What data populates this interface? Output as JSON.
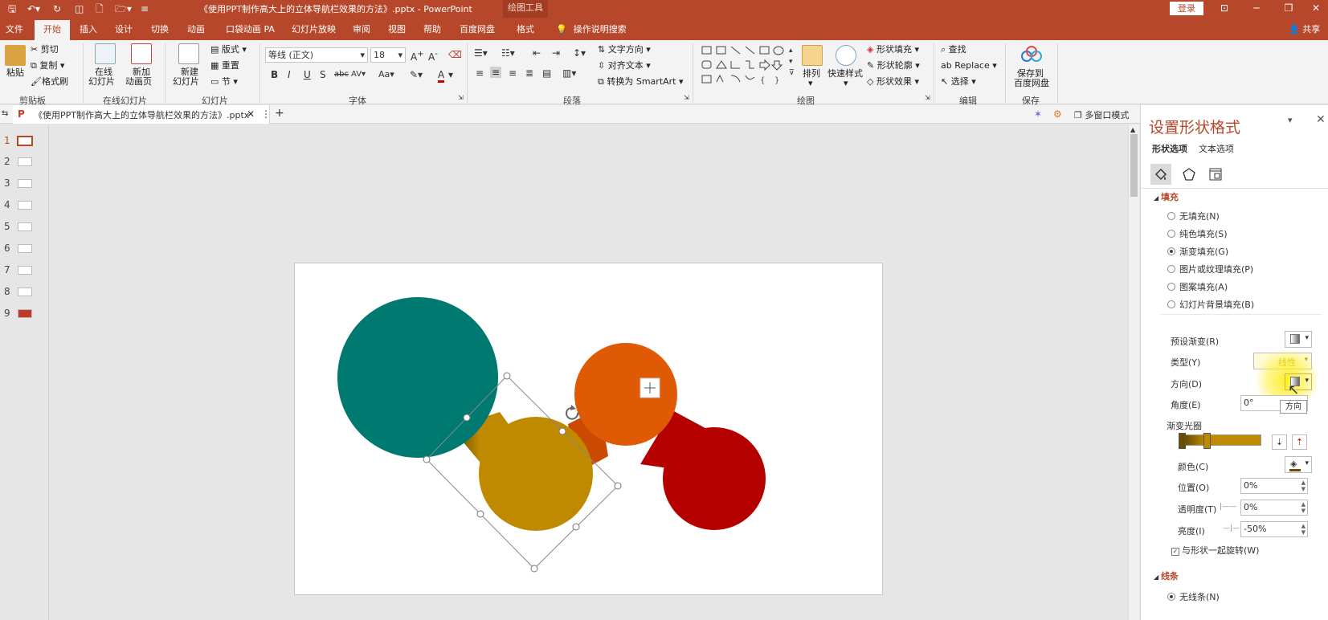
{
  "titlebar": {
    "doc_title": "《使用PPT制作高大上的立体导航栏效果的方法》.pptx  -  PowerPoint",
    "context_tab": "绘图工具",
    "login": "登录"
  },
  "menu": {
    "tabs": [
      "文件",
      "开始",
      "插入",
      "设计",
      "切换",
      "动画",
      "口袋动画 PA",
      "幻灯片放映",
      "审阅",
      "视图",
      "帮助",
      "百度网盘",
      "格式"
    ],
    "active": "开始",
    "tell_me": "操作说明搜索",
    "share": "共享"
  },
  "ribbon": {
    "clipboard": {
      "paste": "粘贴",
      "cut": "剪切",
      "copy": "复制",
      "format_painter": "格式刷",
      "label": "剪贴板"
    },
    "online": {
      "online_slides_1": "在线",
      "online_slides_2": "幻灯片",
      "new_anim_1": "新加",
      "new_anim_2": "动画页",
      "label": "在线幻灯片"
    },
    "slides": {
      "new_slide_1": "新建",
      "new_slide_2": "幻灯片",
      "layout": "版式",
      "reset": "重置",
      "section": "节",
      "label": "幻灯片"
    },
    "font": {
      "name": "等线 (正文)",
      "size": "18",
      "label": "字体"
    },
    "paragraph": {
      "text_direction": "文字方向",
      "align_text": "对齐文本",
      "smartart": "转换为 SmartArt",
      "label": "段落"
    },
    "drawing": {
      "arrange": "排列",
      "quick_styles": "快速样式",
      "shape_fill": "形状填充",
      "shape_outline": "形状轮廓",
      "shape_effects": "形状效果",
      "label": "绘图"
    },
    "editing": {
      "find": "查找",
      "replace": "Replace",
      "select": "选择",
      "label": "编辑"
    },
    "save": {
      "save_baidu_1": "保存到",
      "save_baidu_2": "百度网盘",
      "label": "保存"
    }
  },
  "doc_tab": {
    "label": "《使用PPT制作高大上的立体导航栏效果的方法》.pptx",
    "multi_window": "多窗口模式"
  },
  "thumbnails": [
    "1",
    "2",
    "3",
    "4",
    "5",
    "6",
    "7",
    "8",
    "9"
  ],
  "colors": {
    "teal": "#007a70",
    "orange": "#e05a06",
    "gold": "#bf8a00",
    "red": "#b50000",
    "accent": "#b7472a"
  },
  "pane": {
    "title": "设置形状格式",
    "tab_shape": "形状选项",
    "tab_text": "文本选项",
    "fill_section": "填充",
    "fill_options": [
      "无填充(N)",
      "纯色填充(S)",
      "渐变填充(G)",
      "图片或纹理填充(P)",
      "图案填充(A)",
      "幻灯片背景填充(B)"
    ],
    "fill_selected": 2,
    "preset_gradient": "预设渐变(R)",
    "type_label": "类型(Y)",
    "type_value": "线性",
    "direction_label": "方向(D)",
    "direction_tooltip": "方向",
    "angle_label": "角度(E)",
    "angle_value": "0°",
    "stops_label": "渐变光圈",
    "color_label": "颜色(C)",
    "position_label": "位置(O)",
    "position_value": "0%",
    "transparency_label": "透明度(T)",
    "transparency_value": "0%",
    "brightness_label": "亮度(I)",
    "brightness_value": "-50%",
    "rotate_with_shape": "与形状一起旋转(W)",
    "line_section": "线条",
    "line_no": "无线条(N)"
  }
}
